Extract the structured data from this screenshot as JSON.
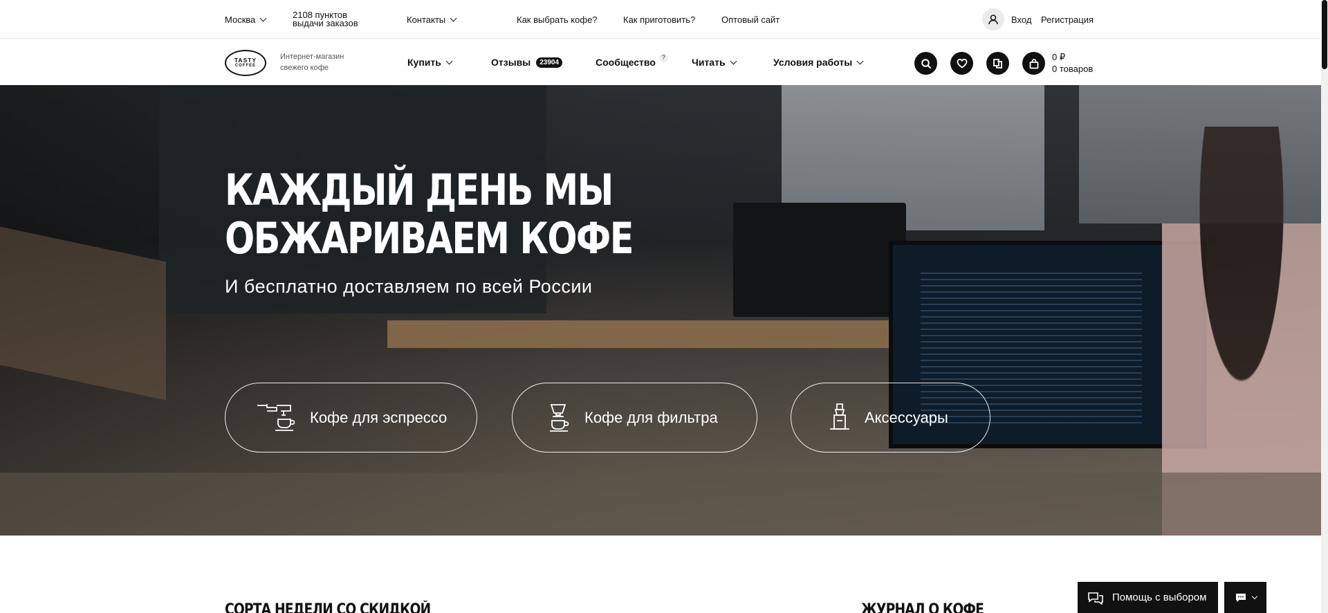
{
  "topbar": {
    "city": "Москва",
    "pickup_line1": "2108 пунктов",
    "pickup_line2": "выдачи заказов",
    "contacts": "Контакты",
    "how_choose": "Как выбрать кофе?",
    "how_make": "Как приготовить?",
    "wholesale": "Оптовый сайт",
    "login": "Вход",
    "register": "Регистрация"
  },
  "brand": {
    "logo_line1": "TASTY",
    "logo_line2": "COFFEE",
    "tagline": "Интернет-магазин свежего кофе"
  },
  "nav": {
    "buy": "Купить",
    "reviews": "Отзывы",
    "reviews_count": "23904",
    "community": "Сообщество",
    "community_hint": "?",
    "read": "Читать",
    "terms": "Условия работы"
  },
  "cart": {
    "sum": "0 ₽",
    "items": "0 товаров"
  },
  "hero": {
    "title_line1": "КАЖДЫЙ ДЕНЬ МЫ",
    "title_line2": "ОБЖАРИВАЕМ КОФЕ",
    "subtitle": "И бесплатно доставляем по всей России",
    "categories": [
      {
        "label": "Кофе для эспрессо",
        "icon": "espresso-machine-icon"
      },
      {
        "label": "Кофе для фильтра",
        "icon": "pour-over-icon"
      },
      {
        "label": "Аксессуары",
        "icon": "grinder-icon"
      }
    ]
  },
  "sections": {
    "left_title": "СОРТА НЕДЕЛИ СО СКИДКОЙ",
    "right_title": "ЖУРНАЛ О КОФЕ"
  },
  "help": {
    "label": "Помощь с выбором"
  },
  "colors": {
    "accent": "#111111",
    "background": "#ffffff"
  }
}
